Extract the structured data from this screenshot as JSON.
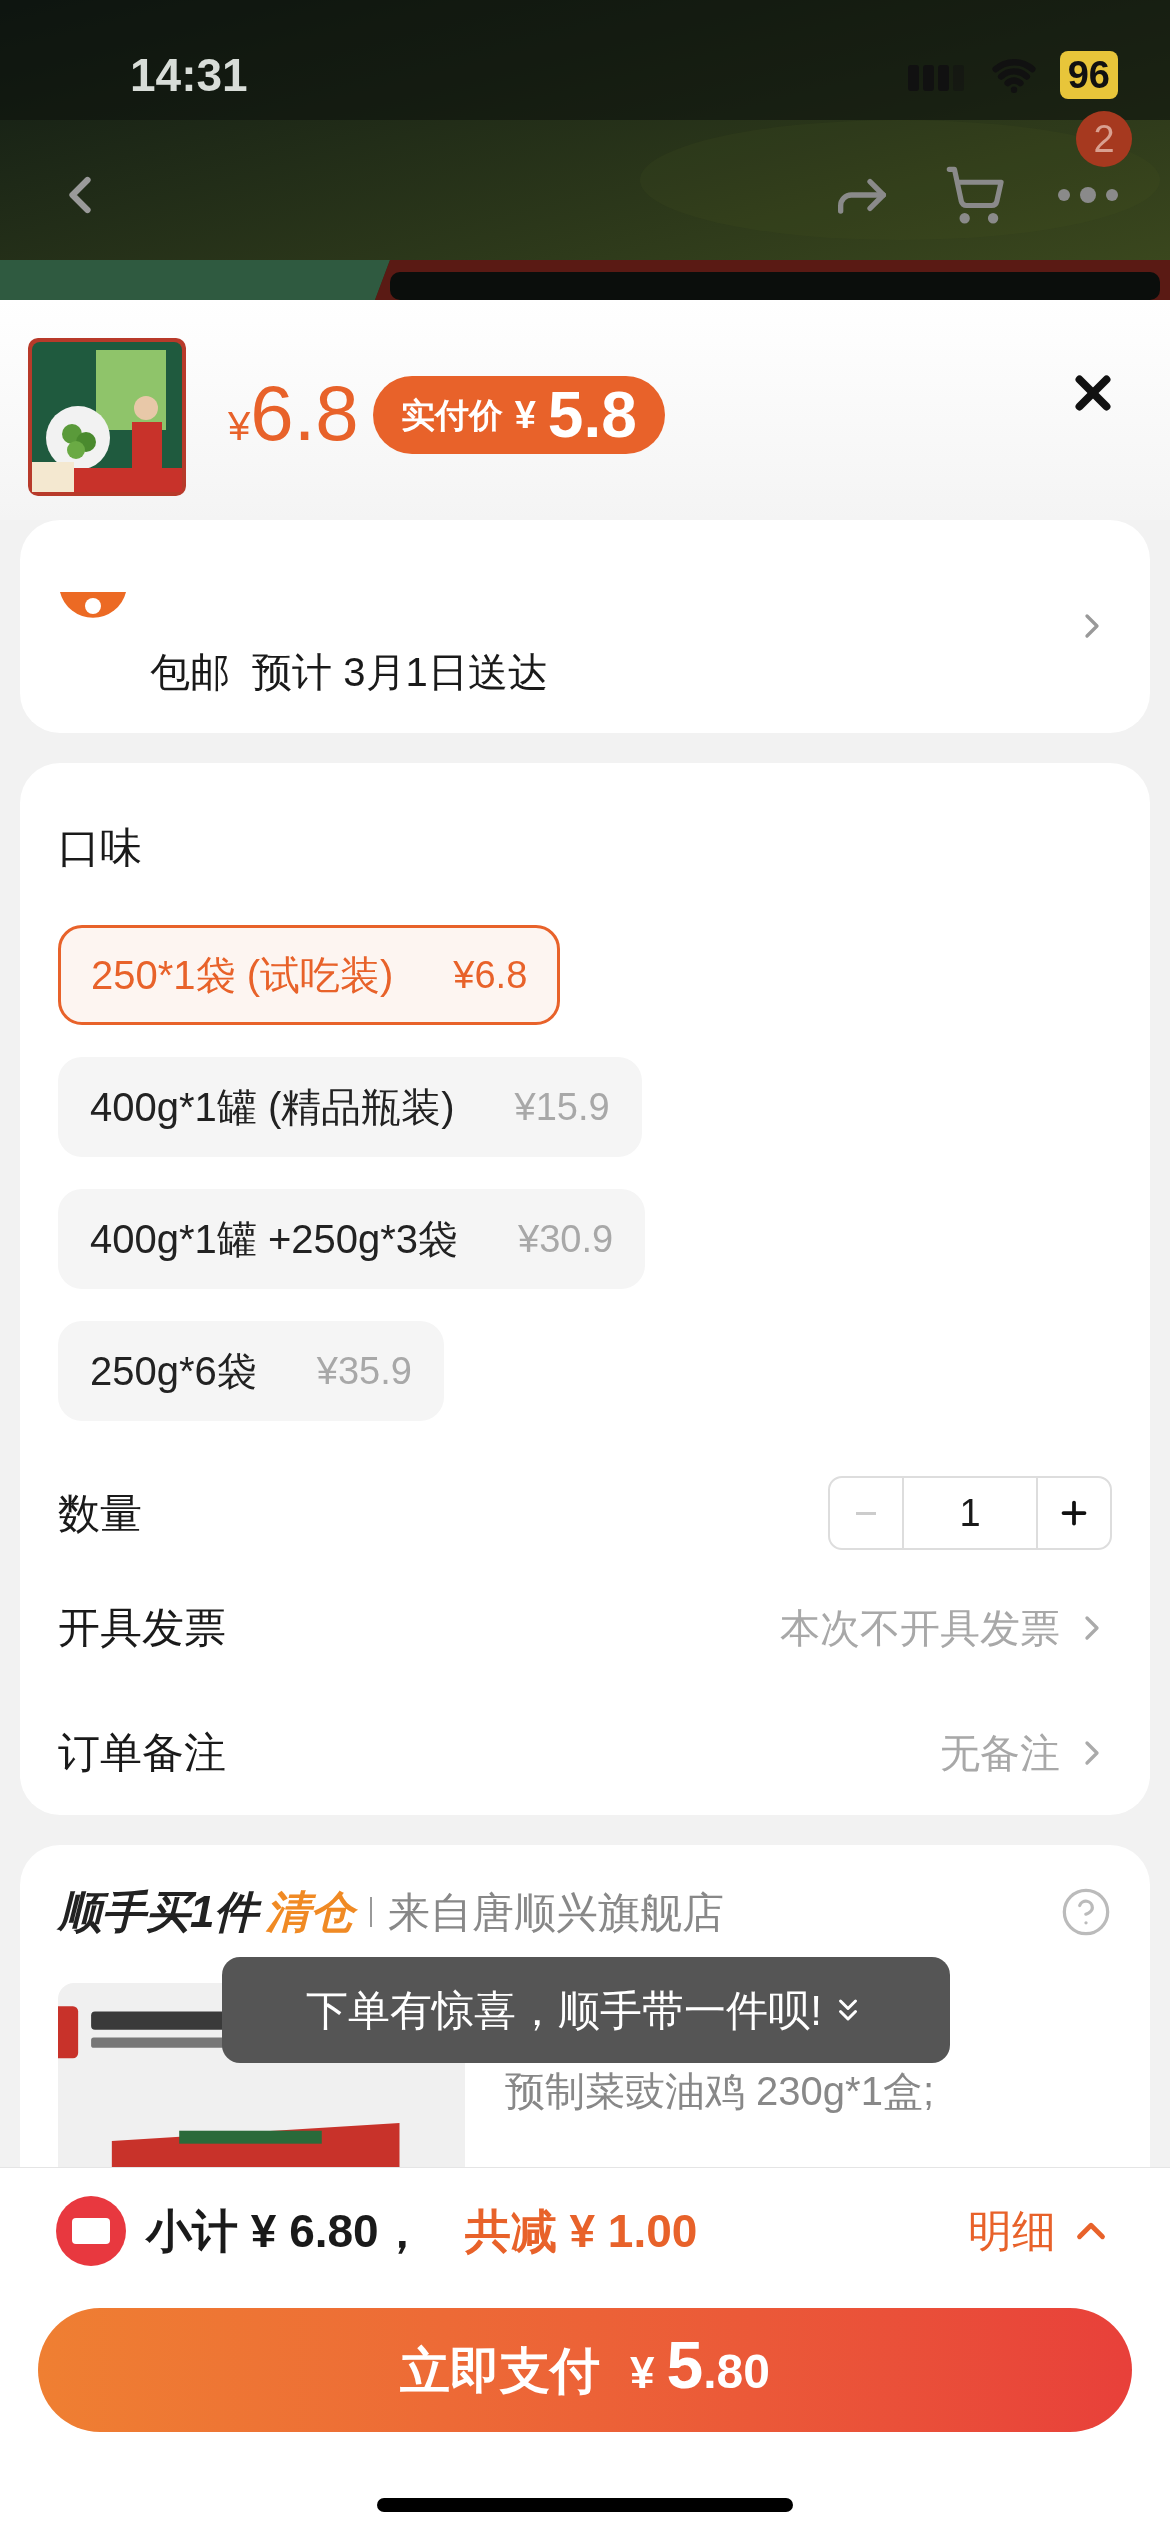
{
  "status_bar": {
    "time": "14:31",
    "battery": "96"
  },
  "nav": {
    "more_badge": "2"
  },
  "product": {
    "price_symbol": "¥",
    "price": "6.8",
    "paid_label": "实付价",
    "paid_symbol": "¥",
    "paid_price": "5.8"
  },
  "delivery": {
    "shipping": "包邮",
    "eta": "预计 3月1日送达"
  },
  "options": {
    "title": "口味",
    "items": [
      {
        "label": "250*1袋 (试吃装)",
        "price": "¥6.8",
        "selected": true
      },
      {
        "label": "400g*1罐 (精品瓶装)",
        "price": "¥15.9",
        "selected": false
      },
      {
        "label": "400g*1罐 +250g*3袋",
        "price": "¥30.9",
        "selected": false
      },
      {
        "label": "250g*6袋",
        "price": "¥35.9",
        "selected": false
      }
    ]
  },
  "quantity": {
    "label": "数量",
    "value": "1",
    "minus_disabled": true
  },
  "rows": [
    {
      "label": "开具发票",
      "value": "本次不开具发票"
    },
    {
      "label": "订单备注",
      "value": "无备注"
    }
  ],
  "addon": {
    "title": "顺手买1件",
    "tag": "清仓",
    "source": "来自唐顺兴旗舰店",
    "description": "预制菜豉油鸡 230g*1盒;"
  },
  "toast": "下单有惊喜，顺手带一件呗!",
  "summary": {
    "subtotal": "小计 ¥ 6.80，",
    "discount": "共减 ¥ 1.00",
    "detail": "明细"
  },
  "pay_button": {
    "label": "立即支付",
    "symbol": "¥",
    "integer": "5",
    "decimal": ".80"
  }
}
